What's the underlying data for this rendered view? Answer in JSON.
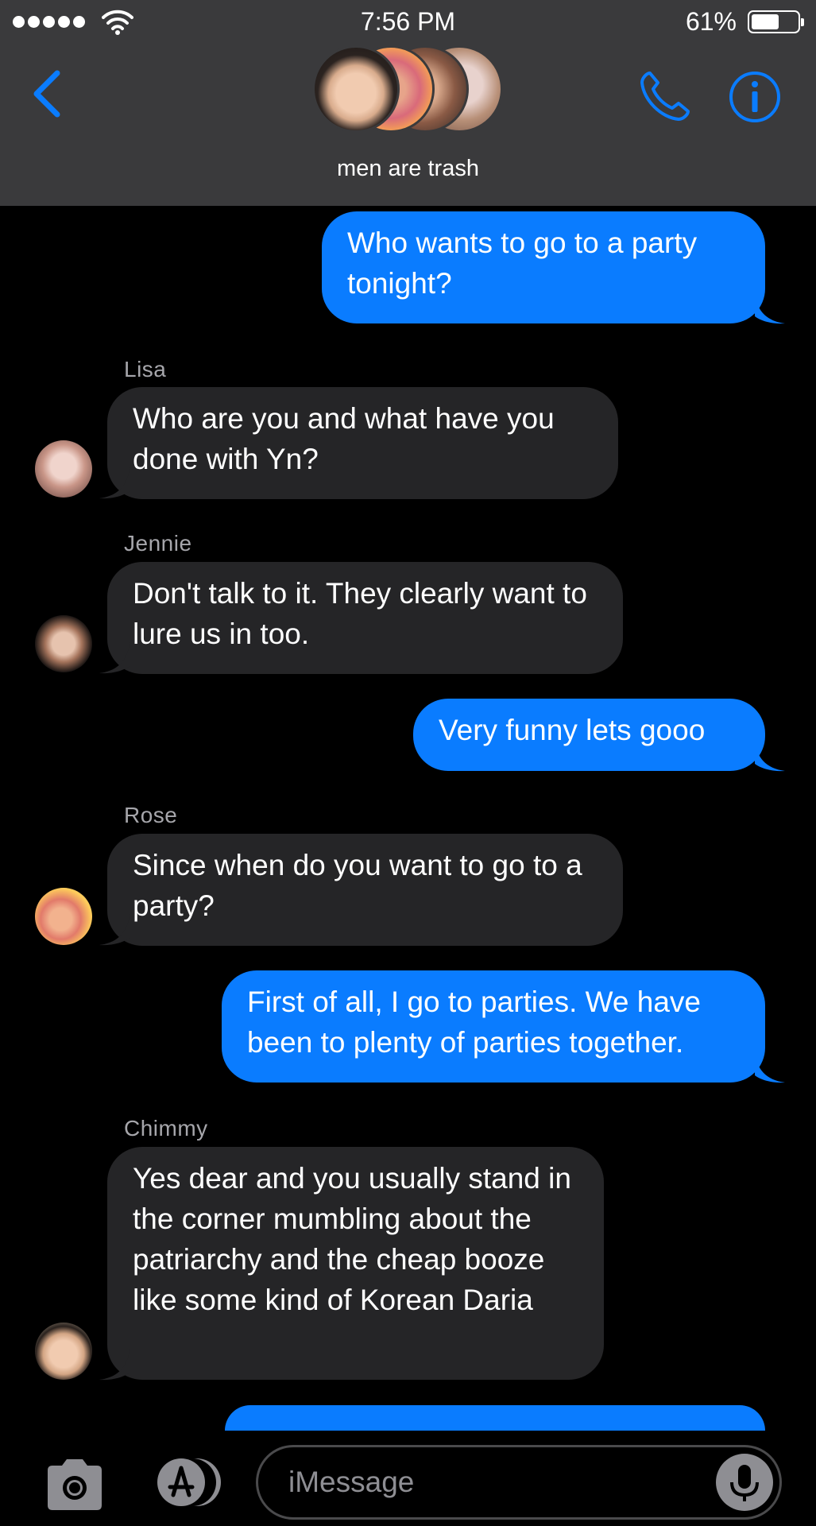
{
  "status_bar": {
    "time": "7:56 PM",
    "battery_percent": "61%",
    "battery_level": 0.61
  },
  "header": {
    "group_name": "men are trash",
    "accent_color": "#0a7cff"
  },
  "messages": [
    {
      "direction": "outgoing",
      "text": "Who wants to go to a party tonight?"
    },
    {
      "direction": "incoming",
      "sender": "Lisa",
      "text": "Who are you and what have you done with Yn?"
    },
    {
      "direction": "incoming",
      "sender": "Jennie",
      "text": "Don't talk to it. They clearly want to lure us in too."
    },
    {
      "direction": "outgoing",
      "text": "Very funny lets gooo"
    },
    {
      "direction": "incoming",
      "sender": "Rose",
      "text": "Since when do you want to go to a party?"
    },
    {
      "direction": "outgoing",
      "text": "First of all, I go to parties. We have been to plenty of parties together."
    },
    {
      "direction": "incoming",
      "sender": "Chimmy",
      "text": "Yes dear and you usually stand in the corner mumbling about the patriarchy and the cheap booze like some kind of Korean Daria"
    }
  ],
  "input": {
    "placeholder": "iMessage"
  },
  "icons": {
    "back": "chevron-left-icon",
    "call": "phone-icon",
    "info": "info-icon",
    "camera": "camera-icon",
    "apps": "app-store-icon",
    "mic": "microphone-icon"
  },
  "colors": {
    "header_bg": "#3a3a3c",
    "outgoing_bubble": "#0a7cff",
    "incoming_bubble": "#252527",
    "sender_label": "#a6a6ab"
  }
}
